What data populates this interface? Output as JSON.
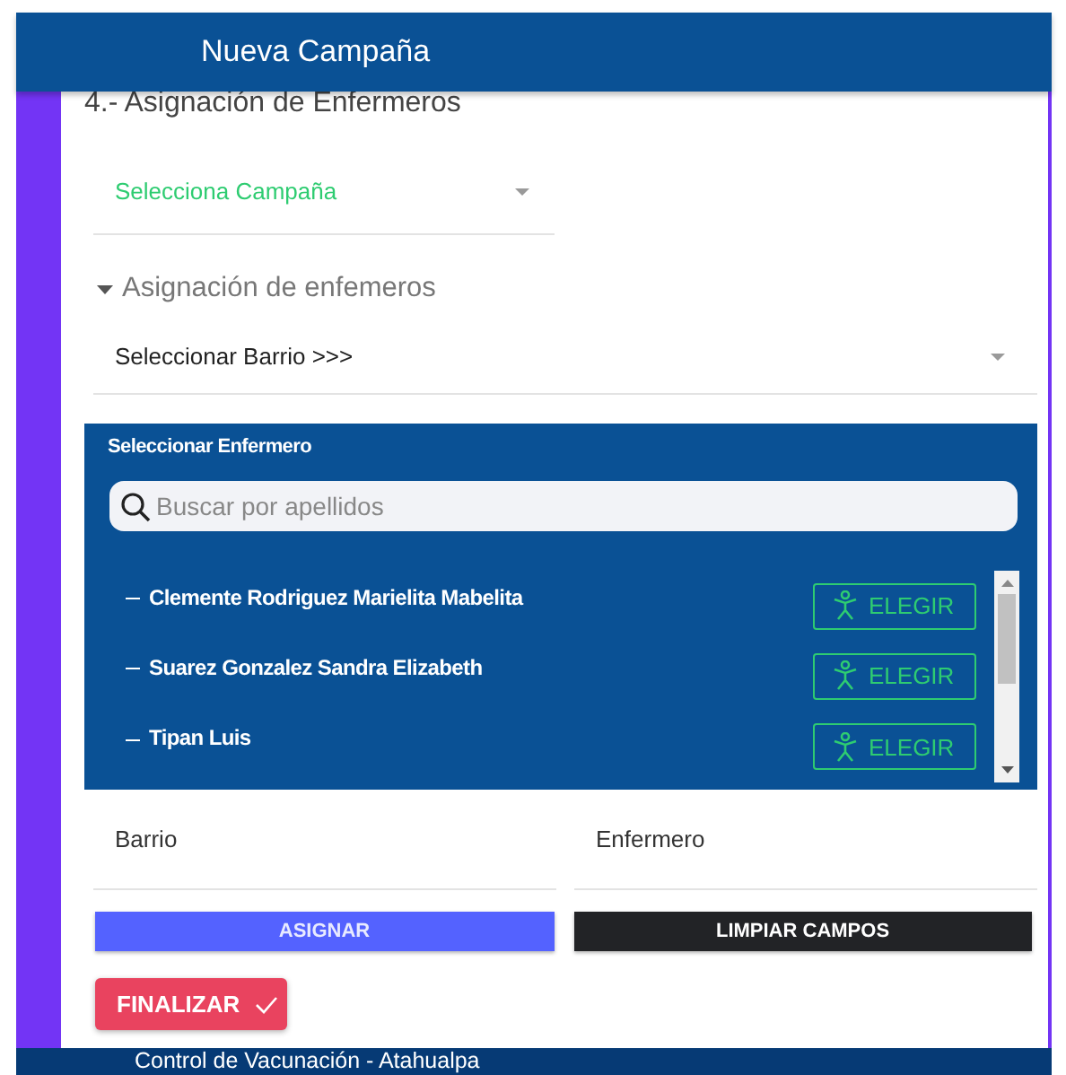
{
  "header": {
    "title": "Nueva Campaña"
  },
  "section_title": "4.- Asignación de Enfermeros",
  "campaign_select": {
    "placeholder": "Selecciona Campaña"
  },
  "expansion": {
    "title": "Asignación de enfemeros",
    "expanded": true
  },
  "barrio_select": {
    "value": "Seleccionar Barrio >>>"
  },
  "nurse_panel": {
    "title": "Seleccionar Enfermero",
    "search": {
      "placeholder": "Buscar por apellidos"
    },
    "nurses": [
      {
        "name": "Clemente Rodriguez Marielita Mabelita",
        "action": "ELEGIR"
      },
      {
        "name": "Suarez Gonzalez Sandra Elizabeth",
        "action": "ELEGIR"
      },
      {
        "name": "Tipan Luis",
        "action": "ELEGIR"
      }
    ]
  },
  "fields": [
    {
      "label": "Barrio"
    },
    {
      "label": "Enfermero"
    }
  ],
  "buttons": [
    {
      "label": "ASIGNAR",
      "kind": "primary"
    },
    {
      "label": "LIMPIAR CAMPOS",
      "kind": "dark"
    }
  ],
  "finish_button": {
    "label": "FINALIZAR"
  },
  "footer": {
    "text": "Control de Vacunación - Atahualpa"
  }
}
